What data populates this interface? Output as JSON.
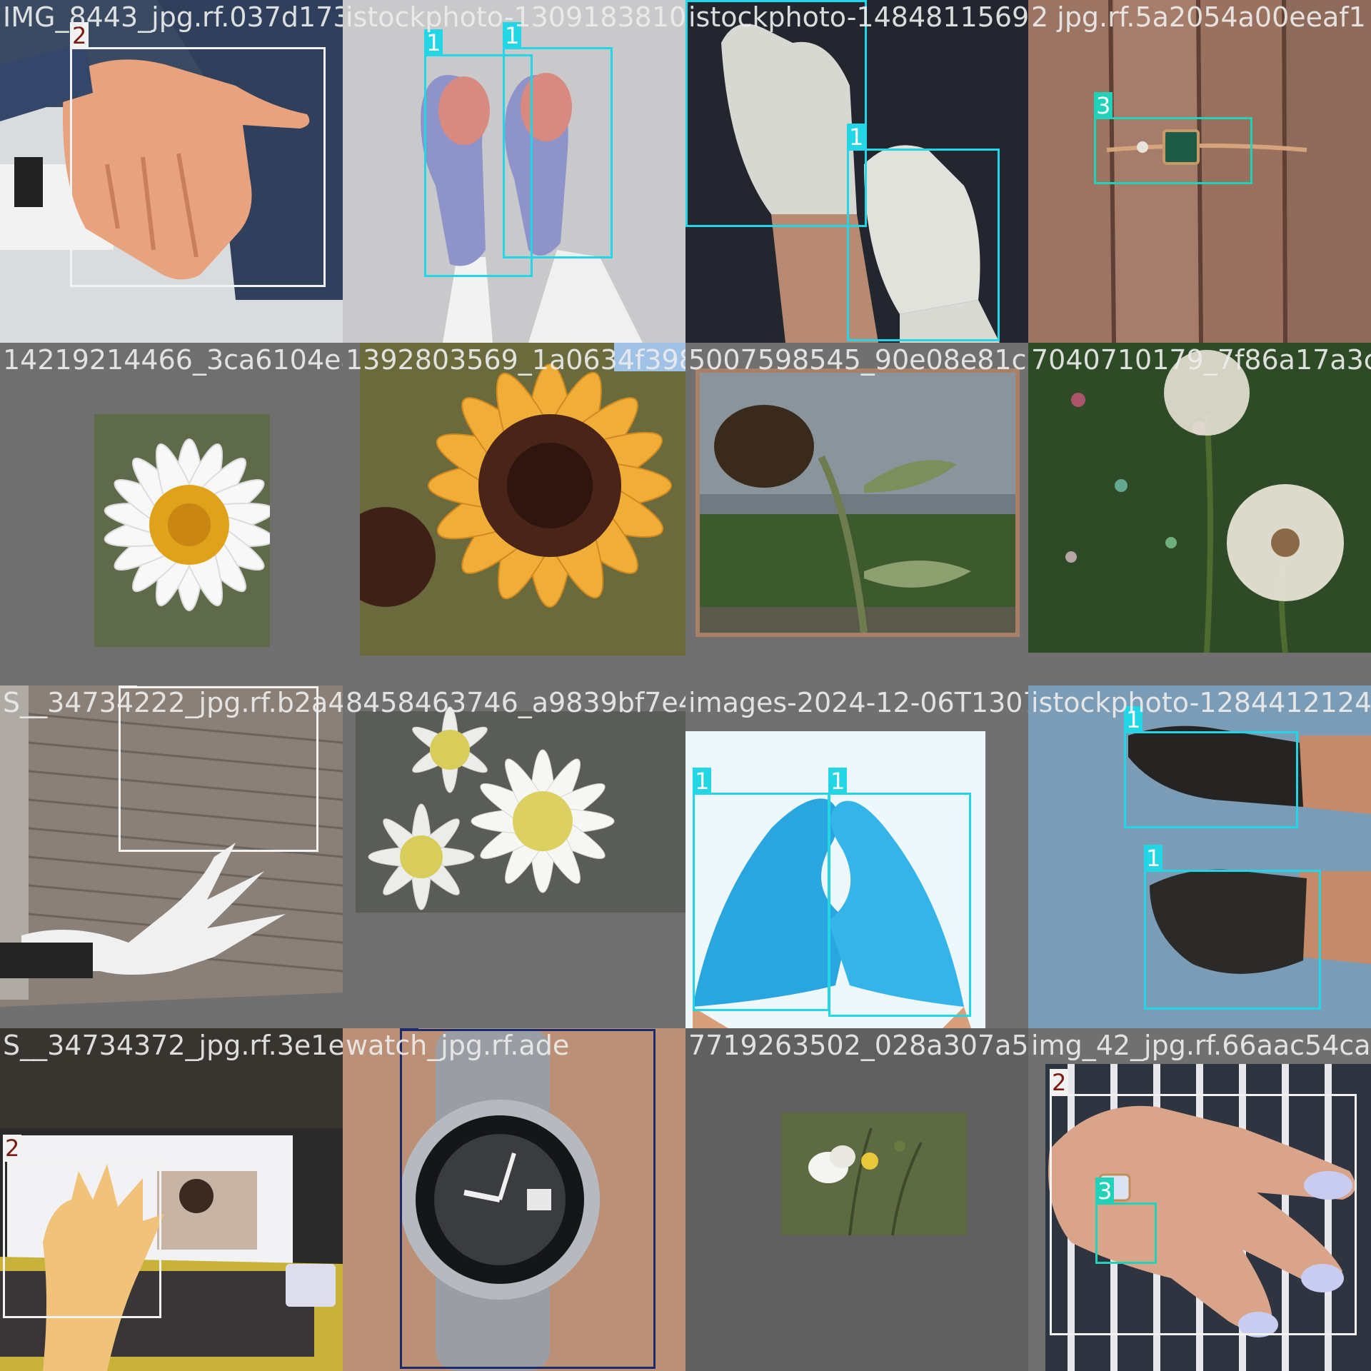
{
  "label_colors": {
    "1": "#22d6e6",
    "2": "#f2f2f2",
    "3": "#22d2b8",
    "4": "#1a2a6a"
  },
  "tiles": [
    {
      "filename": "IMG_8443_jpg.rf.037d173d2fa64206004e3809",
      "scene": "palm-of-hand",
      "boxes": [
        {
          "label": "2"
        }
      ]
    },
    {
      "filename": "istockphoto-1309183810-612x612_jpg.rf",
      "scene": "blue-gloves-holding-hearts",
      "boxes": [
        {
          "label": "1"
        },
        {
          "label": "1"
        }
      ]
    },
    {
      "filename": "istockphoto-1484811569-612x612_jpg.rf.4",
      "scene": "white-gloves",
      "boxes": [
        {
          "label": "1"
        },
        {
          "label": "1"
        }
      ]
    },
    {
      "filename": "2 jpg.rf.5a2054a00eeaf1",
      "scene": "emerald-ring-on-finger",
      "boxes": [
        {
          "label": "3"
        }
      ]
    },
    {
      "filename": "14219214466_3ca6104eae_n.jpg",
      "scene": "white-daisy",
      "boxes": []
    },
    {
      "filename": "1392803569_1a0634f398_m.jpg",
      "scene": "sunflower-closeup",
      "boxes": []
    },
    {
      "filename": "5007598545_90e08e81c1_n.jpg",
      "scene": "sunflower-field",
      "boxes": []
    },
    {
      "filename": "7040710179_7f86a17a3c_n",
      "scene": "dandelion-seedheads",
      "boxes": []
    },
    {
      "filename": "S__34734222_jpg.rf.b2a47c",
      "scene": "hand-in-front-of-blinds",
      "boxes": [
        {
          "label": "2"
        }
      ]
    },
    {
      "filename": "8458463746_a9839bf7e4.jpg",
      "scene": "daisy-bouquet",
      "boxes": []
    },
    {
      "filename": "images-2024-12-06T130716",
      "scene": "blue-gloves-heart-shape",
      "boxes": [
        {
          "label": "1"
        },
        {
          "label": "1"
        }
      ]
    },
    {
      "filename": "istockphoto-1284412124-61",
      "scene": "black-gloves",
      "boxes": [
        {
          "label": "1"
        },
        {
          "label": "1"
        }
      ]
    },
    {
      "filename": "S__34734372_jpg.rf.3e1eab",
      "scene": "hand-over-laptop",
      "boxes": [
        {
          "label": "2"
        }
      ]
    },
    {
      "filename": "watch_jpg.rf.ade",
      "scene": "wristwatch",
      "boxes": [
        {
          "label": "4"
        }
      ]
    },
    {
      "filename": "7719263502_028a307a5d.jpg",
      "scene": "butterfly-on-flowers",
      "boxes": []
    },
    {
      "filename": "img_42_jpg.rf.66aac54cac3f",
      "scene": "hand-with-diamond-ring",
      "boxes": [
        {
          "label": "2"
        },
        {
          "label": "3"
        }
      ]
    }
  ]
}
